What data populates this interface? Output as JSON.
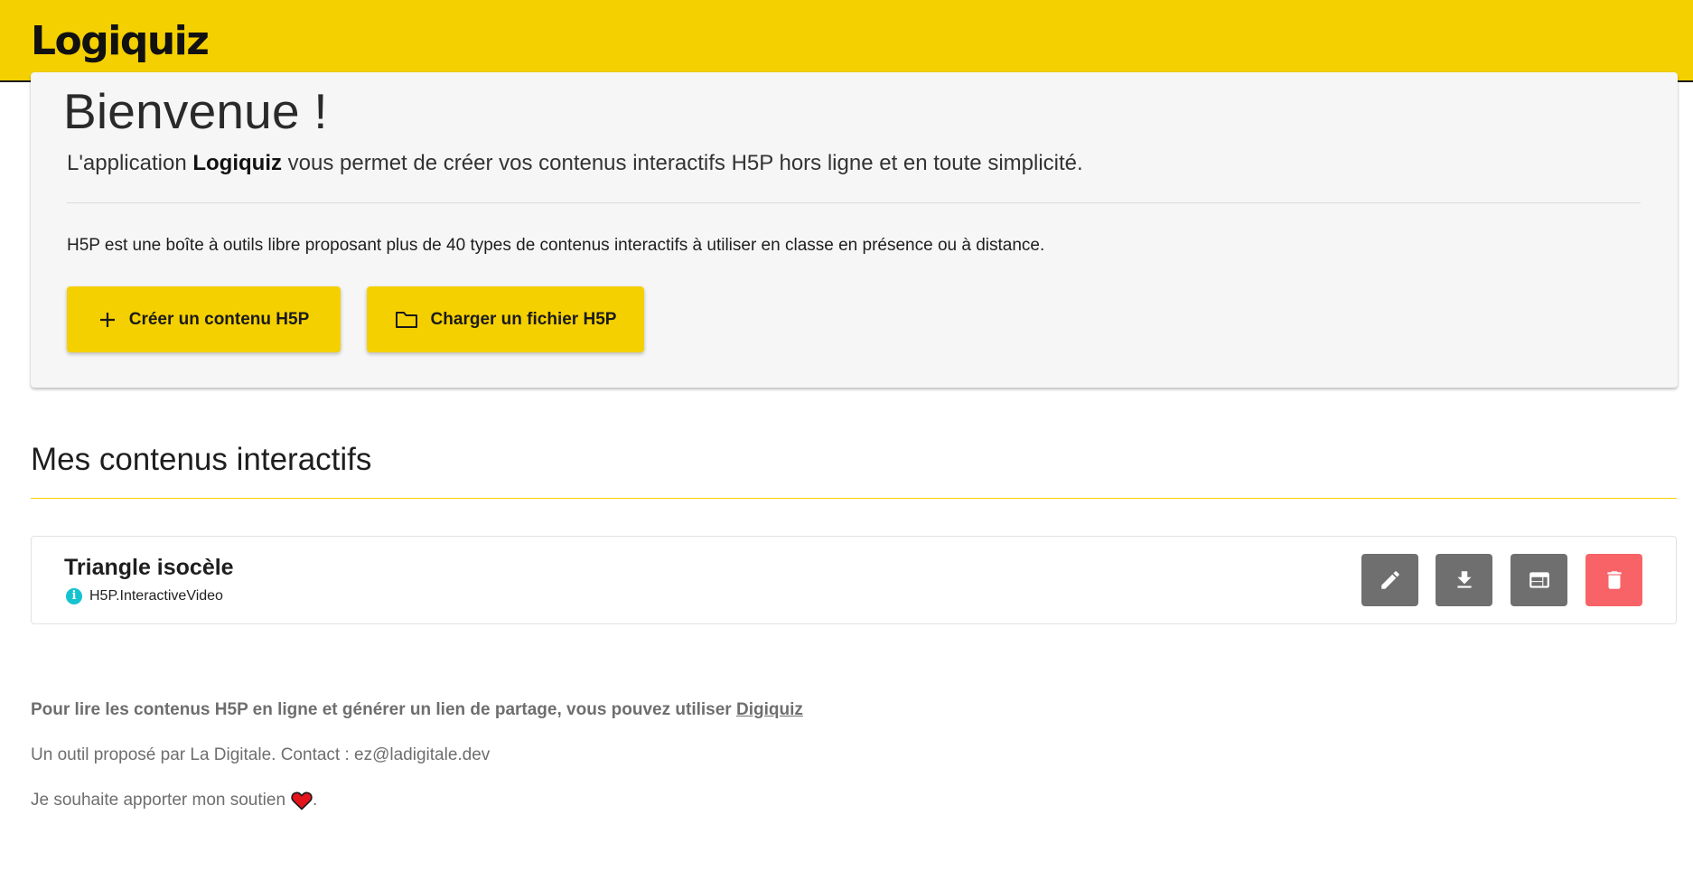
{
  "header": {
    "app_name": "Logiquiz",
    "bg_color": "#f5d000"
  },
  "welcome": {
    "title": "Bienvenue !",
    "intro_prefix": "L'application ",
    "intro_app": "Logiquiz",
    "intro_suffix": " vous permet de créer vos contenus interactifs H5P hors ligne et en toute simplicité.",
    "description": "H5P est une boîte à outils libre proposant plus de 40 types de contenus interactifs à utiliser en classe en présence ou à distance.",
    "create_button": {
      "label": "Créer un contenu H5P",
      "icon": "plus-icon"
    },
    "load_button": {
      "label": "Charger un fichier H5P",
      "icon": "folder-icon"
    }
  },
  "contents": {
    "title": "Mes contenus interactifs",
    "items": [
      {
        "title": "Triangle isocèle",
        "type": "H5P.InteractiveVideo",
        "type_icon": "info-icon",
        "actions": [
          {
            "name": "edit",
            "icon": "pencil-icon",
            "color": "#6f6f6f"
          },
          {
            "name": "download",
            "icon": "download-icon",
            "color": "#6f6f6f"
          },
          {
            "name": "embed",
            "icon": "embed-icon",
            "color": "#6f6f6f"
          },
          {
            "name": "delete",
            "icon": "trash-icon",
            "color": "#f76367"
          }
        ]
      }
    ]
  },
  "footer": {
    "read_online_text": "Pour lire les contenus H5P en ligne et générer un lien de partage, vous pouvez utiliser ",
    "read_online_link": "Digiquiz",
    "credit": "Un outil proposé par La Digitale. Contact : ez@ladigitale.dev",
    "support_text": "Je souhaite apporter mon soutien",
    "support_end": ".",
    "support_icon": "heart-icon"
  },
  "colors": {
    "accent": "#f5d000",
    "info": "#15c3d0",
    "action_gray": "#6f6f6f",
    "danger": "#f76367"
  }
}
